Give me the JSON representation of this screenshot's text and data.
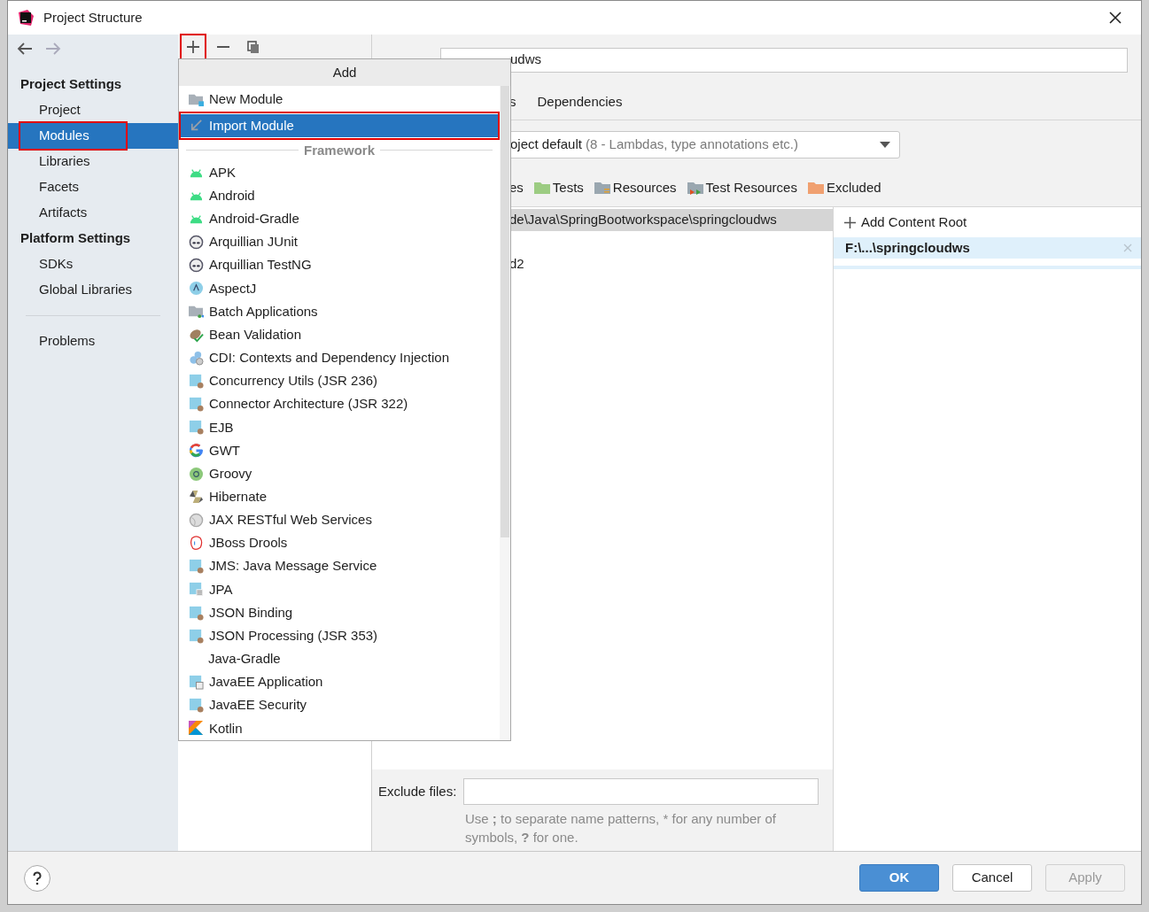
{
  "window": {
    "title": "Project Structure"
  },
  "toolbar": [
    {
      "kind": "add",
      "outlined": true
    },
    {
      "kind": "remove",
      "outlined": false
    },
    {
      "kind": "copy",
      "outlined": false
    }
  ],
  "sidebar": {
    "sections": [
      {
        "title": "Project Settings",
        "items": [
          {
            "label": "Project",
            "selected": false,
            "outlined": false
          },
          {
            "label": "Modules",
            "selected": true,
            "outlined": true
          },
          {
            "label": "Libraries",
            "selected": false,
            "outlined": false
          },
          {
            "label": "Facets",
            "selected": false,
            "outlined": false
          },
          {
            "label": "Artifacts",
            "selected": false,
            "outlined": false
          }
        ]
      },
      {
        "title": "Platform Settings",
        "items": [
          {
            "label": "SDKs",
            "selected": false,
            "outlined": false
          },
          {
            "label": "Global Libraries",
            "selected": false,
            "outlined": false
          }
        ]
      }
    ],
    "extra_items": [
      {
        "label": "Problems",
        "selected": false
      }
    ]
  },
  "module": {
    "name_value": "udws",
    "tabs": [
      {
        "label": "s",
        "selected": false
      },
      {
        "label": "Dependencies",
        "selected": false
      }
    ],
    "language_level": {
      "value": "oject default",
      "hint": "(8 - Lambdas, type annotations etc.)"
    },
    "mark_as": [
      {
        "label": "es",
        "kind": "none"
      },
      {
        "label": "Tests",
        "kind": "tests"
      },
      {
        "label": "Resources",
        "kind": "resources"
      },
      {
        "label": "Test Resources",
        "kind": "test-resources"
      },
      {
        "label": "Excluded",
        "kind": "excluded"
      }
    ],
    "tree": [
      {
        "label": "de\\Java\\SpringBootworkspace\\springcloudws",
        "selected": true
      },
      {
        "label": "d2",
        "selected": false
      }
    ],
    "add_content_root": "Add Content Root",
    "content_roots": [
      {
        "label": "F:\\...\\springcloudws",
        "selected": true
      }
    ],
    "exclude_label": "Exclude files:",
    "exclude_help": "Use **;** to separate name patterns, * for any number of symbols, **?** for one."
  },
  "popup": {
    "title": "Add",
    "items": [
      {
        "label": "New Module",
        "kind": "folder",
        "selected": false,
        "outlined": false
      },
      {
        "label": "Import Module",
        "kind": "import",
        "selected": true,
        "outlined": true
      }
    ],
    "section": "Framework",
    "frameworks": [
      {
        "label": "APK",
        "kind": "android"
      },
      {
        "label": "Android",
        "kind": "android"
      },
      {
        "label": "Android-Gradle",
        "kind": "android"
      },
      {
        "label": "Arquillian JUnit",
        "kind": "alien"
      },
      {
        "label": "Arquillian TestNG",
        "kind": "alien"
      },
      {
        "label": "AspectJ",
        "kind": "aspect"
      },
      {
        "label": "Batch Applications",
        "kind": "batch"
      },
      {
        "label": "Bean Validation",
        "kind": "bean"
      },
      {
        "label": "CDI: Contexts and Dependency Injection",
        "kind": "cdi"
      },
      {
        "label": "Concurrency Utils (JSR 236)",
        "kind": "javaee"
      },
      {
        "label": "Connector Architecture (JSR 322)",
        "kind": "javaee"
      },
      {
        "label": "EJB",
        "kind": "javaee"
      },
      {
        "label": "GWT",
        "kind": "google"
      },
      {
        "label": "Groovy",
        "kind": "groovy"
      },
      {
        "label": "Hibernate",
        "kind": "hibernate"
      },
      {
        "label": "JAX RESTful Web Services",
        "kind": "globe"
      },
      {
        "label": "JBoss Drools",
        "kind": "drools"
      },
      {
        "label": "JMS: Java Message Service",
        "kind": "javaee"
      },
      {
        "label": "JPA",
        "kind": "jpa"
      },
      {
        "label": "JSON Binding",
        "kind": "javaee"
      },
      {
        "label": "JSON Processing (JSR 353)",
        "kind": "javaee"
      },
      {
        "label": "Java-Gradle",
        "kind": "none"
      },
      {
        "label": "JavaEE Application",
        "kind": "javaee-app"
      },
      {
        "label": "JavaEE Security",
        "kind": "javaee"
      },
      {
        "label": "Kotlin",
        "kind": "kotlin"
      }
    ]
  },
  "footer": {
    "buttons": [
      {
        "label": "OK",
        "kind": "primary",
        "disabled": false
      },
      {
        "label": "Cancel",
        "kind": "normal",
        "disabled": false
      },
      {
        "label": "Apply",
        "kind": "normal",
        "disabled": true
      }
    ]
  }
}
